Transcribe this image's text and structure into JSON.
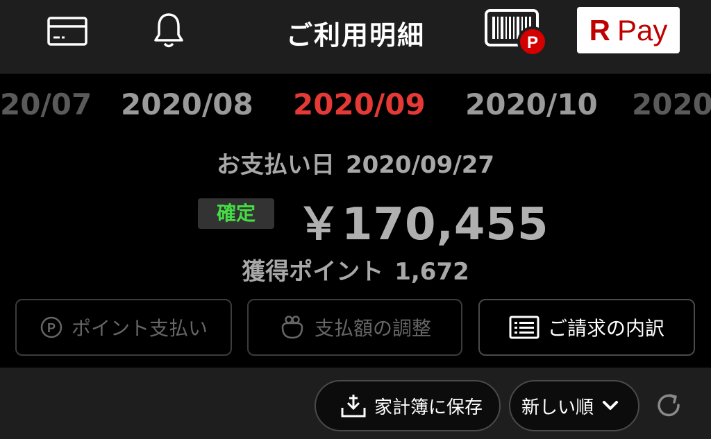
{
  "header": {
    "title": "ご利用明細",
    "icons": [
      "card-icon",
      "bell-icon",
      "barcode-point-icon",
      "rpay-logo"
    ],
    "barcode_badge": "P",
    "rpay_logo": {
      "r": "R",
      "pay": "Pay"
    }
  },
  "months": {
    "items": [
      "20/07",
      "2020/08",
      "2020/09",
      "2020/10",
      "2020/"
    ],
    "selected": "2020/09"
  },
  "summary": {
    "payment_date_label": "お支払い日",
    "payment_date": "2020/09/27",
    "status_badge": "確定",
    "amount": "￥170,455",
    "points_label": "獲得ポイント",
    "points_value": "1,672"
  },
  "actions": {
    "point_payment": "ポイント支払い",
    "adjust_amount": "支払額の調整",
    "billing_details": "ご請求の内訳"
  },
  "toolbar": {
    "save_household": "家計簿に保存",
    "sort_order": "新しい順",
    "refresh_icon": "refresh-icon"
  },
  "colors": {
    "accent_red": "#e53935",
    "confirmed_green": "#44dd44",
    "rpay_red": "#bf0000",
    "background": "#000000",
    "header_bg": "#1e1e1e"
  }
}
